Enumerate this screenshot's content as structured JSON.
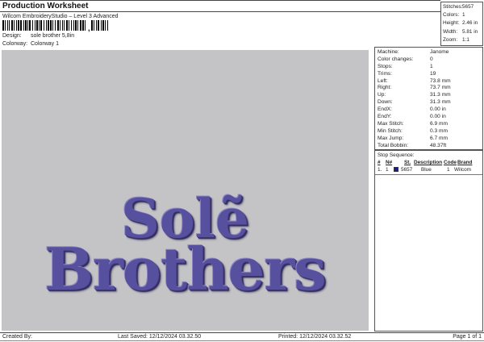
{
  "header": {
    "title": "Production Worksheet",
    "subtitle": "Wilcom EmbroideryStudio – Level 3 Advanced",
    "design_label": "Design:",
    "design_value": "sole brother 5,8in",
    "colorway_label": "Colorway:",
    "colorway_value": "Colorway 1"
  },
  "barcode": {
    "groups": [
      "21121112211211212211211122121121112212112121121221121112211212112112212112",
      "211211221121121"
    ],
    "separator": ","
  },
  "stats": {
    "rows": [
      {
        "label": "Stitches:",
        "value": "5657"
      },
      {
        "label": "Colors:",
        "value": "1"
      },
      {
        "label": "Height:",
        "value": "2.46 in"
      },
      {
        "label": "Width:",
        "value": "5.81 in"
      },
      {
        "label": "Zoom:",
        "value": "1:1"
      }
    ]
  },
  "machine": {
    "rows": [
      {
        "label": "Machine:",
        "value": "Janome"
      },
      {
        "label": "Color changes:",
        "value": "0"
      },
      {
        "label": "Stops:",
        "value": "1"
      },
      {
        "label": "Trims:",
        "value": "19"
      },
      {
        "label": "Left:",
        "value": "73.8 mm"
      },
      {
        "label": "Right:",
        "value": "73.7 mm"
      },
      {
        "label": "Up:",
        "value": "31.3 mm"
      },
      {
        "label": "Down:",
        "value": "31.3 mm"
      },
      {
        "label": "EndX:",
        "value": "0.00 in"
      },
      {
        "label": "EndY:",
        "value": "0.00 in"
      },
      {
        "label": "Max Stitch:",
        "value": "6.9 mm"
      },
      {
        "label": "Min Stitch:",
        "value": "0.3 mm"
      },
      {
        "label": "Max Jump:",
        "value": "6.7 mm"
      },
      {
        "label": "Total Bobbin:",
        "value": "48.37ft"
      }
    ]
  },
  "stop_sequence": {
    "title": "Stop Sequence:",
    "columns": {
      "num": "#",
      "n": "N#",
      "st": "St.",
      "description": "Description",
      "code": "Code",
      "brand": "Brand"
    },
    "rows": [
      {
        "num": "1.",
        "n": "1",
        "swatch": "#1b1b8e",
        "st": "5657",
        "description": "Blue",
        "code": "1",
        "brand": "Wilcom"
      }
    ]
  },
  "design": {
    "line1": "Solẽ",
    "line2": "Brothers",
    "thread_color": "#57509e",
    "background_color": "#c4c3c6"
  },
  "footer": {
    "created_by": "Created By:",
    "last_saved": "Last Saved: 12/12/2024 03.32.50",
    "printed": "Printed: 12/12/2024 03.32.52",
    "page": "Page 1 of 1"
  }
}
